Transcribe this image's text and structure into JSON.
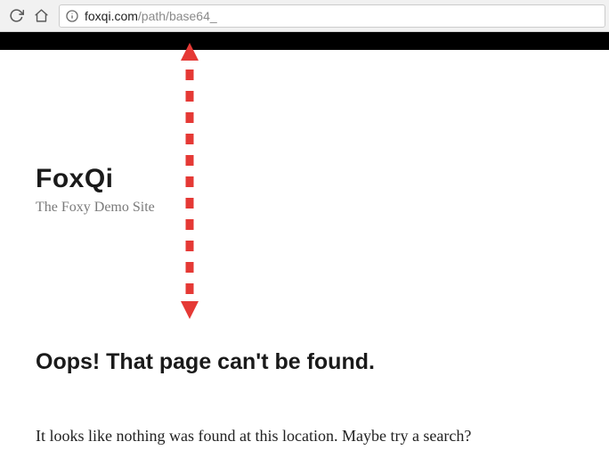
{
  "address": {
    "domain": "foxqi.com",
    "path": "/path/base64_"
  },
  "site": {
    "title": "FoxQi",
    "tagline": "The Foxy Demo Site"
  },
  "error": {
    "heading": "Oops! That page can't be found.",
    "body": "It looks like nothing was found at this location. Maybe try a search?"
  }
}
